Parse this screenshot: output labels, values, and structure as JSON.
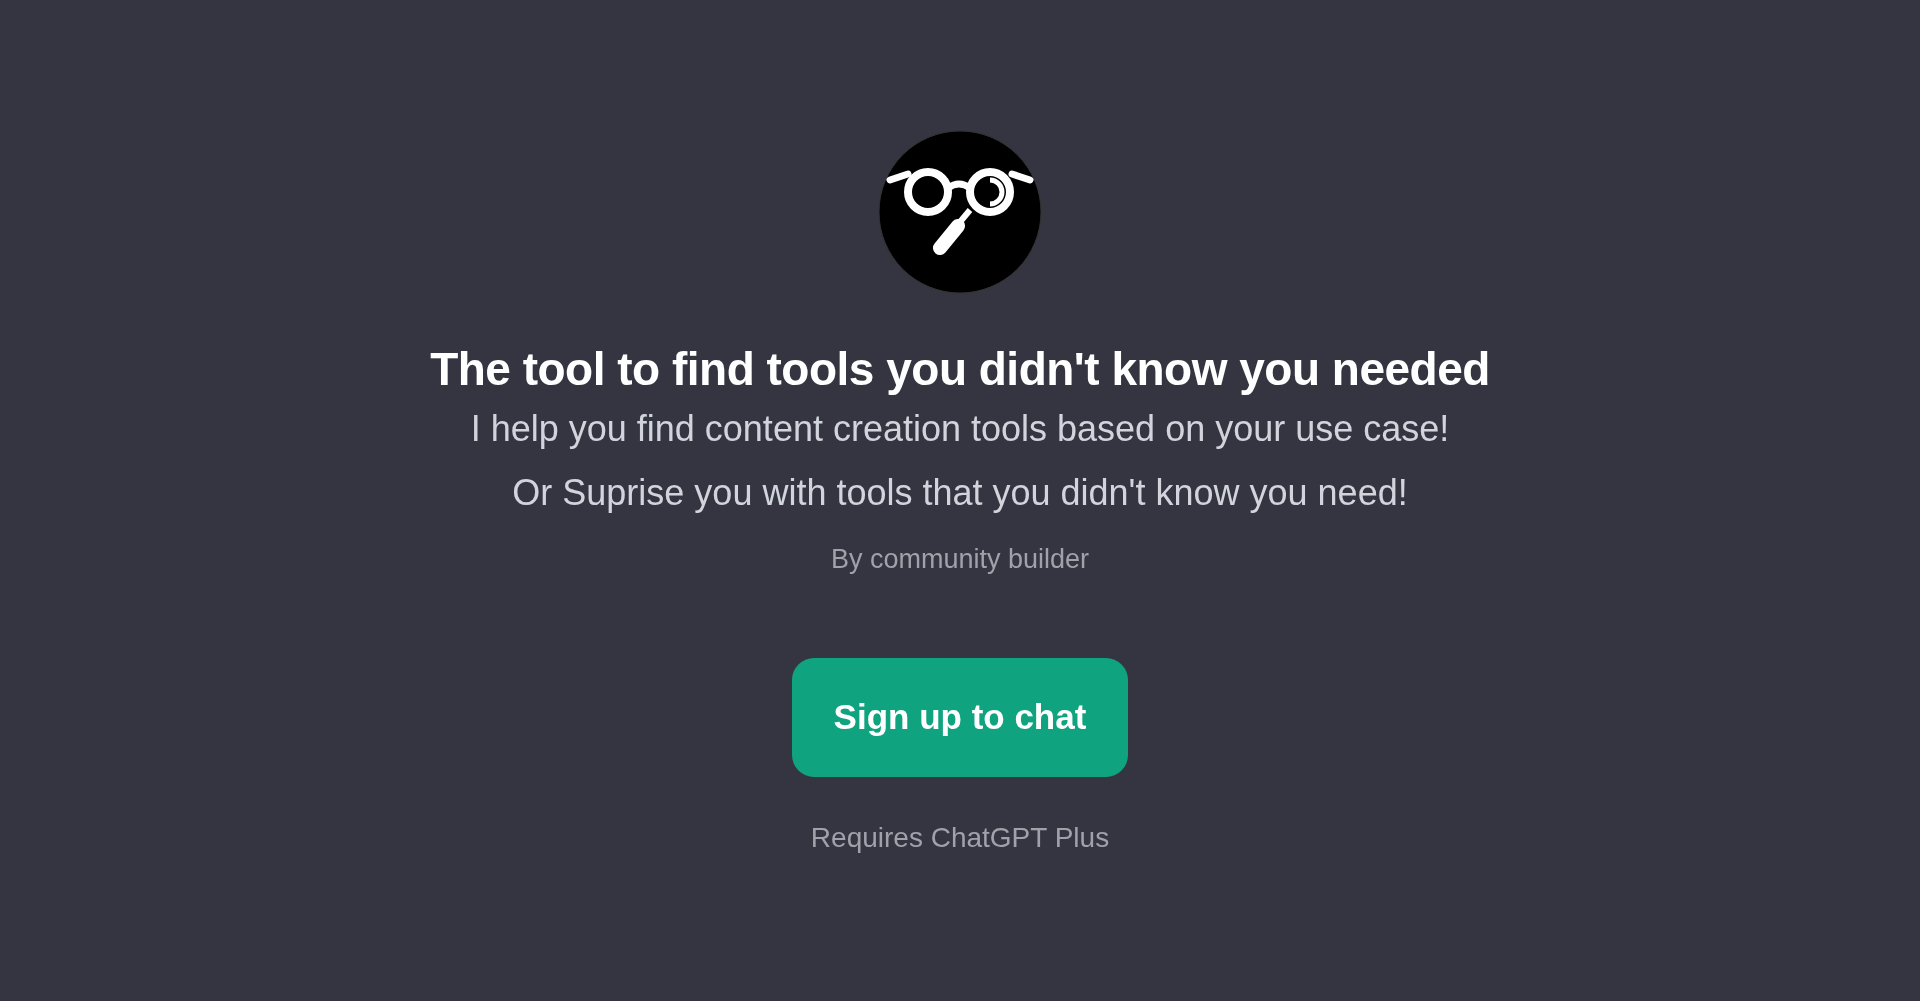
{
  "title": "The tool to find tools you didn't know you needed",
  "description": "I help you find content creation tools based on your use case! Or Suprise you with tools that you didn't know you need!",
  "author": "By community builder",
  "button": "Sign up to chat",
  "note": "Requires ChatGPT Plus"
}
